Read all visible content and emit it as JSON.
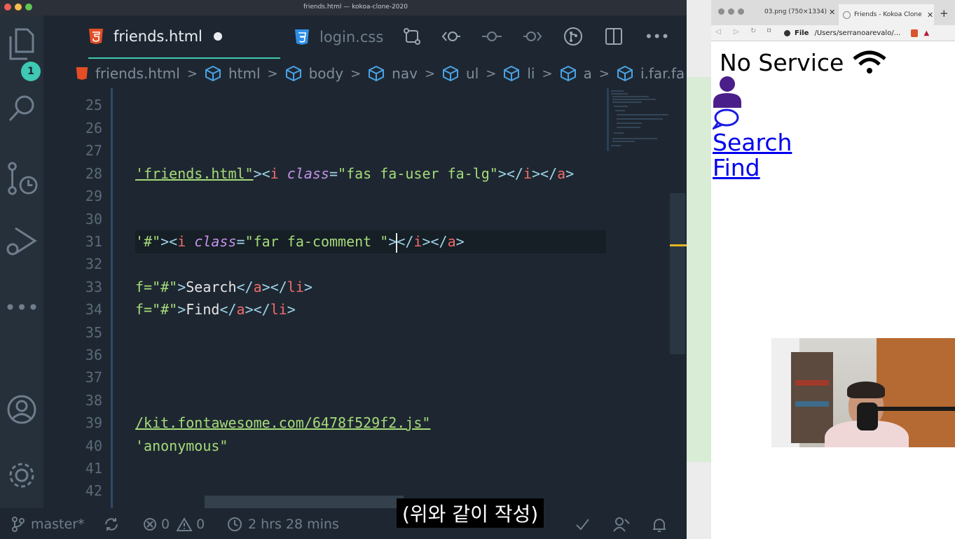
{
  "window": {
    "title": "friends.html — kokoa-clone-2020"
  },
  "activity_bar": {
    "source_control_badge": "1"
  },
  "tabs": [
    {
      "label": "friends.html",
      "type": "html",
      "active": true,
      "modified": true
    },
    {
      "label": "login.css",
      "type": "css",
      "active": false,
      "modified": false
    }
  ],
  "breadcrumb": [
    "friends.html",
    "html",
    "body",
    "nav",
    "ul",
    "li",
    "a",
    "i.far.fa"
  ],
  "editor": {
    "line_numbers": [
      "25",
      "26",
      "27",
      "28",
      "29",
      "30",
      "31",
      "32",
      "33",
      "34",
      "35",
      "36",
      "37",
      "38",
      "39",
      "40",
      "41",
      "42"
    ],
    "line28": {
      "s1": "'friends.html\"",
      "p1": "><",
      "t1": "i",
      "a1": "class",
      "p2": "=",
      "s2": "\"fas fa-user fa-lg\"",
      "p3": "></",
      "t2": "i",
      "p4": "></",
      "t3": "a",
      "p5": ">"
    },
    "line31": {
      "s1": "'#\"",
      "p1": "><",
      "t1": "i",
      "a1": "class",
      "p2": "=",
      "s2": "\"far fa-comment \"",
      "p3": "></",
      "t2": "i",
      "p4": "></",
      "t3": "a",
      "p5": ">"
    },
    "line33": {
      "s1": "f=\"#\"",
      "p1": ">",
      "x1": "Search",
      "p2": "</",
      "t1": "a",
      "p3": "></",
      "t2": "li",
      "p4": ">"
    },
    "line34": {
      "s1": "f=\"#\"",
      "p1": ">",
      "x1": "Find",
      "p2": "</",
      "t1": "a",
      "p3": "></",
      "t2": "li",
      "p4": ">"
    },
    "line39": "/kit.fontawesome.com/6478f529f2.js\"",
    "line40": "'anonymous\""
  },
  "status": {
    "branch": "master*",
    "errors": "0",
    "warnings": "0",
    "time": "2 hrs 28 mins"
  },
  "browser": {
    "tab1": "03.png (750×1334)",
    "tab2": "Friends - Kokoa Clone",
    "address_prefix": "File",
    "address": "/Users/serranoarevalo/...",
    "page": {
      "status_text": "No Service",
      "links": [
        "Search",
        "Find"
      ]
    }
  },
  "subtitle": "(위와 같이 작성)",
  "colors": {
    "accent": "#3fc8b4",
    "editor_bg": "#1e2731",
    "link": "#0000ee",
    "icon_purple": "#4b1f8a"
  }
}
